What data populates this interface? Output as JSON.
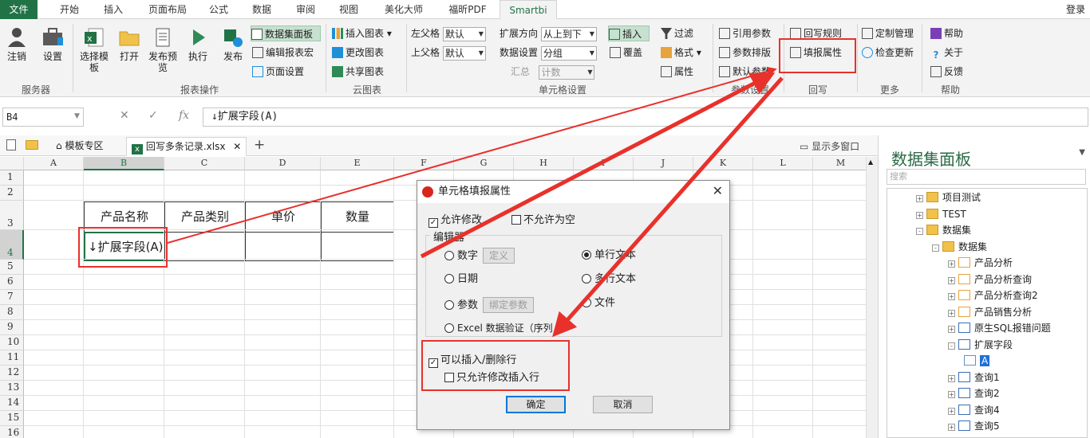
{
  "tabs": [
    "文件",
    "开始",
    "插入",
    "页面布局",
    "公式",
    "数据",
    "审阅",
    "视图",
    "美化大师",
    "福昕PDF",
    "Smartbi"
  ],
  "login": "登录",
  "ribbon": {
    "server": {
      "logout": "注销",
      "settings": "设置",
      "group": "服务器"
    },
    "report": {
      "select_template": "选择模板",
      "open": "打开",
      "publish_preview": "发布预览",
      "execute": "执行",
      "publish": "发布",
      "dataset_panel": "数据集面板",
      "edit_macro": "编辑报表宏",
      "page_setup": "页面设置",
      "group": "报表操作"
    },
    "cloud": {
      "insert_chart": "插入图表",
      "update_chart": "更改图表",
      "share_chart": "共享图表",
      "group": "云图表"
    },
    "cell": {
      "left_parent": "左父格",
      "left_parent_value": "默认",
      "top_parent": "上父格",
      "top_parent_value": "默认",
      "expand_dir": "扩展方向",
      "expand_dir_value": "从上到下",
      "data_setting": "数据设置",
      "data_setting_value": "分组",
      "summary": "汇总",
      "summary_value": "计数",
      "insert": "插入",
      "overwrite": "覆盖",
      "filter": "过滤",
      "format": "格式",
      "property": "属性",
      "group": "单元格设置"
    },
    "param": {
      "ref_param": "引用参数",
      "param_layout": "参数排版",
      "default_param": "默认参数",
      "group": "参数设置"
    },
    "writeback": {
      "rules": "回写规则",
      "fill_property": "填报属性",
      "group": "回写"
    },
    "more": {
      "custom": "定制管理",
      "check_update": "检查更新",
      "group": "更多"
    },
    "help": {
      "help": "帮助",
      "about": "关于",
      "feedback": "反馈",
      "group": "帮助"
    }
  },
  "formula_bar": {
    "cell_ref": "B4",
    "formula": "↓扩展字段(A)"
  },
  "doc_tabs": {
    "template_area": "模板专区",
    "file": "回写多条记录.xlsx",
    "show_multi": "显示多窗口"
  },
  "sheet": {
    "columns": [
      "A",
      "B",
      "C",
      "D",
      "E",
      "F",
      "G",
      "H",
      "I",
      "J",
      "K",
      "L",
      "M"
    ],
    "rows": [
      "1",
      "2",
      "3",
      "4",
      "5",
      "6",
      "7",
      "8",
      "9",
      "10",
      "11",
      "12",
      "13",
      "14",
      "15",
      "16"
    ],
    "headers": [
      "产品名称",
      "产品类别",
      "单价",
      "数量"
    ],
    "b4": "↓扩展字段(A)"
  },
  "panel": {
    "title": "数据集面板",
    "search_placeholder": "搜索",
    "tree": [
      "项目测试",
      "TEST",
      "数据集",
      "数据集",
      "产品分析",
      "产品分析查询",
      "产品分析查询2",
      "产品销售分析",
      "原生SQL报错问题",
      "扩展字段",
      "A",
      "查询1",
      "查询2",
      "查询4",
      "查询5"
    ]
  },
  "dialog": {
    "title": "单元格填报属性",
    "allow_modify": "允许修改",
    "not_null": "不允许为空",
    "editor": "编辑器",
    "number": "数字",
    "define": "定义",
    "single_text": "单行文本",
    "date": "日期",
    "multi_text": "多行文本",
    "param": "参数",
    "bind_param": "绑定参数",
    "file": "文件",
    "excel_validation": "Excel 数据验证（序列",
    "allow_insert_delete": "可以插入/删除行",
    "only_modify_inserted": "只允许修改插入行",
    "ok": "确定",
    "cancel": "取消"
  },
  "colors": {
    "excel_green": "#217346",
    "annotation_red": "#e8312b"
  }
}
